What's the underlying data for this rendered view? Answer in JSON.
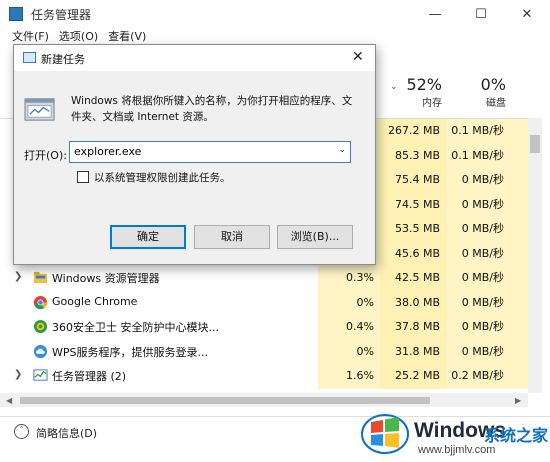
{
  "window": {
    "title": "任务管理器",
    "minimize": "—",
    "maximize": "☐",
    "close": "✕"
  },
  "menu": [
    "文件(F)",
    "选项(O)",
    "查看(V)"
  ],
  "columns": {
    "memory": {
      "percent": "52%",
      "label": "内存"
    },
    "disk": {
      "percent": "0%",
      "label": "磁盘"
    }
  },
  "hidden_rows": [
    {
      "mem": "267.2 MB",
      "disk": "0.1 MB/秒"
    },
    {
      "mem": "85.3 MB",
      "disk": "0.1 MB/秒"
    },
    {
      "mem": "75.4 MB",
      "disk": "0 MB/秒"
    },
    {
      "mem": "74.5 MB",
      "disk": "0 MB/秒"
    },
    {
      "mem": "53.5 MB",
      "disk": "0 MB/秒"
    },
    {
      "mem": "45.6 MB",
      "disk": "0 MB/秒"
    }
  ],
  "rows": [
    {
      "name": "Windows 资源管理器",
      "cpu": "0.3%",
      "mem": "42.5 MB",
      "disk": "0 MB/秒",
      "icon": "folder-icon"
    },
    {
      "name": "Google Chrome",
      "cpu": "0%",
      "mem": "38.0 MB",
      "disk": "0 MB/秒",
      "icon": "chrome-icon"
    },
    {
      "name": "360安全卫士 安全防护中心模块...",
      "cpu": "0.4%",
      "mem": "37.8 MB",
      "disk": "0 MB/秒",
      "icon": "shield-icon"
    },
    {
      "name": "WPS服务程序，提供服务登录...",
      "cpu": "0%",
      "mem": "31.8 MB",
      "disk": "0 MB/秒",
      "icon": "cloud-icon"
    },
    {
      "name": "任务管理器 (2)",
      "cpu": "1.6%",
      "mem": "25.2 MB",
      "disk": "0.2 MB/秒",
      "icon": "task-manager-icon"
    }
  ],
  "footer": {
    "label": "简略信息(D)"
  },
  "dialog": {
    "title": "新建任务",
    "description": "Windows 将根据你所键入的名称，为你打开相应的程序、文件夹、文档或 Internet 资源。",
    "open_label": "打开(O):",
    "open_value": "explorer.exe",
    "admin_checkbox": "以系统管理权限创建此任务。",
    "ok": "确定",
    "cancel": "取消",
    "browse": "浏览(B)...",
    "close": "✕"
  },
  "watermark": {
    "brand": "Windows",
    "suffix": "系统之家",
    "url": "www.bjjmlv.com"
  },
  "colors": {
    "heat": "#fff4c4",
    "accent": "#0078d7",
    "watermark_blue": "#0d6fc7"
  }
}
